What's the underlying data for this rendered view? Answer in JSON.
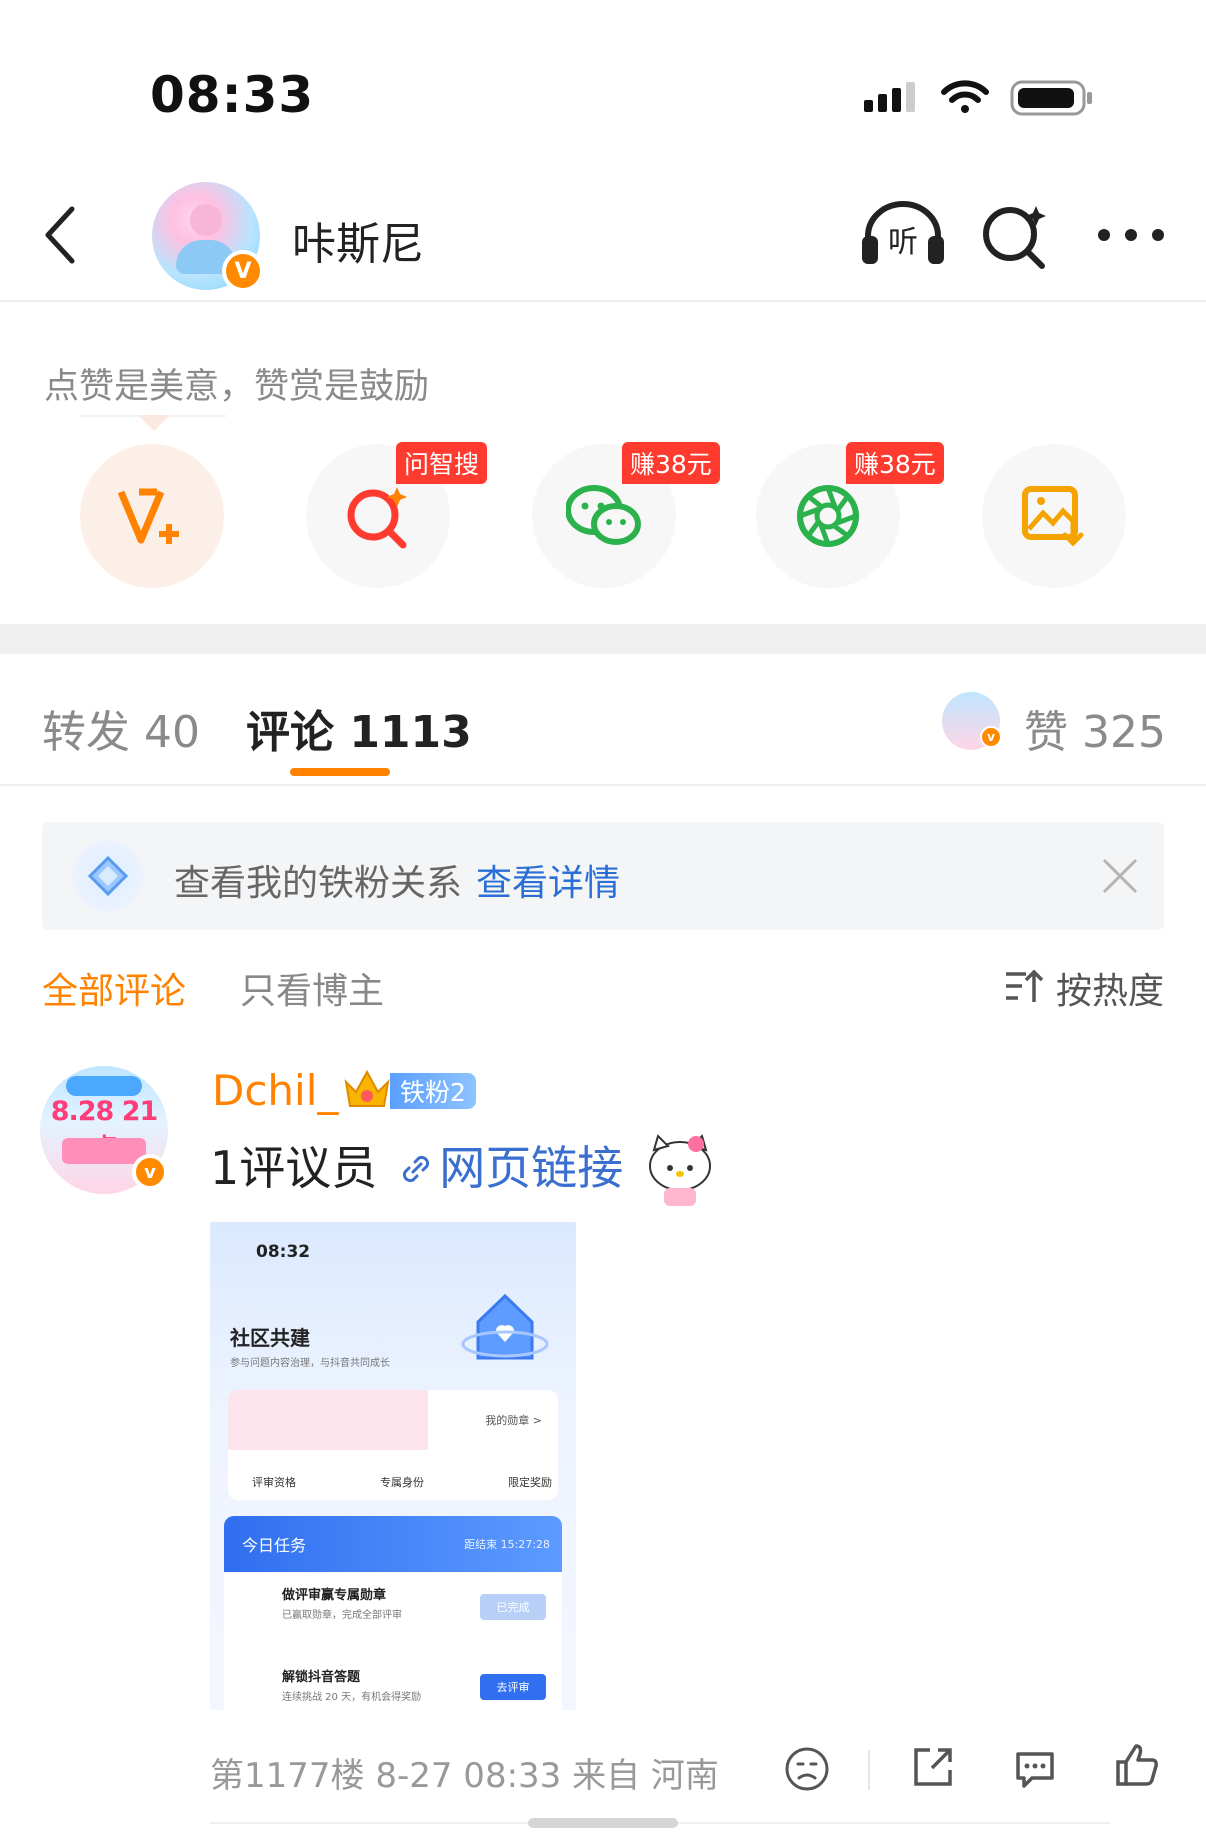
{
  "status_bar": {
    "time": "08:33"
  },
  "header": {
    "username": "咔斯尼",
    "verified_badge": "V"
  },
  "reward": {
    "text": "点赞是美意，赞赏是鼓励",
    "actions": [
      {
        "icon": "v-plus-icon",
        "tag": ""
      },
      {
        "icon": "smart-search-icon",
        "tag": "问智搜"
      },
      {
        "icon": "wechat-icon",
        "tag": "赚38元"
      },
      {
        "icon": "moments-icon",
        "tag": "赚38元"
      },
      {
        "icon": "save-image-icon",
        "tag": ""
      }
    ]
  },
  "tabs": {
    "repost": "转发 40",
    "comments": "评论 1113",
    "likes": "赞 325"
  },
  "fan_banner": {
    "text": "查看我的铁粉关系",
    "link": "查看详情"
  },
  "filters": {
    "all": "全部评论",
    "author_only": "只看博主",
    "sort": "按热度"
  },
  "comment": {
    "avatar_text": "8.28 21点",
    "username": "Dchil_",
    "fan_badge": "铁粉2",
    "content": "1评议员",
    "link_text": "网页链接",
    "meta": "第1177楼  8-27 08:33  来自 河南",
    "screenshot": {
      "time": "08:32",
      "title": "社区共建",
      "subtitle": "参与问题内容治理，与抖音共同成长",
      "medal": "我的勋章 >",
      "row": [
        "评审资格",
        "专属身份",
        "限定奖励"
      ],
      "task_title": "今日任务",
      "task_timer": "距结束 15:27:28",
      "item1": "做评审赢专属勋章",
      "item1_sub": "已赢取勋章，完成全部评审",
      "item1_btn": "已完成",
      "item2": "解锁抖音答题",
      "item2_sub": "连续挑战 20 天，有机会得奖励",
      "item2_btn": "去评审"
    }
  },
  "colors": {
    "accent": "#ff8200",
    "link": "#2a6fd6",
    "tag_red": "#ff3b30"
  }
}
